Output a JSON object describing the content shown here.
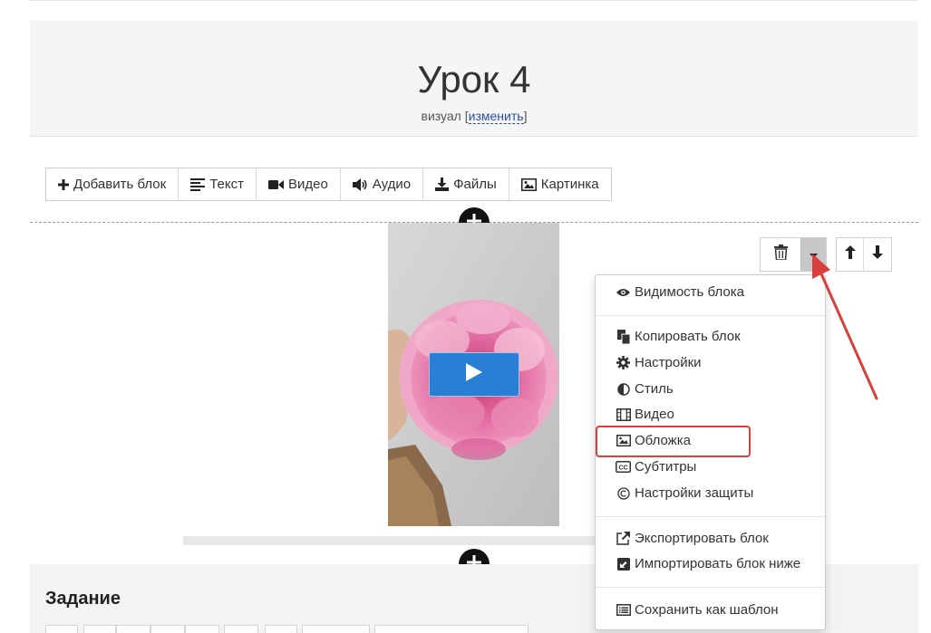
{
  "header": {
    "title": "Урок 4",
    "visual_label": "визуал",
    "change_label": "изменить"
  },
  "toolbar": {
    "add_block": "Добавить блок",
    "text": "Текст",
    "video": "Видео",
    "audio": "Аудио",
    "files": "Файлы",
    "image": "Картинка"
  },
  "menu": {
    "visibility": "Видимость блока",
    "copy": "Копировать блок",
    "settings": "Настройки",
    "style": "Стиль",
    "video": "Видео",
    "cover": "Обложка",
    "subtitles": "Субтитры",
    "protection": "Настройки защиты",
    "export": "Экспортировать блок",
    "import": "Импортировать блок ниже",
    "save_template": "Сохранить как шаблон"
  },
  "task": {
    "title": "Задание"
  },
  "colors": {
    "accent_play": "#2a7fd4",
    "highlight": "#d9403b",
    "link": "#2a4fa1"
  }
}
